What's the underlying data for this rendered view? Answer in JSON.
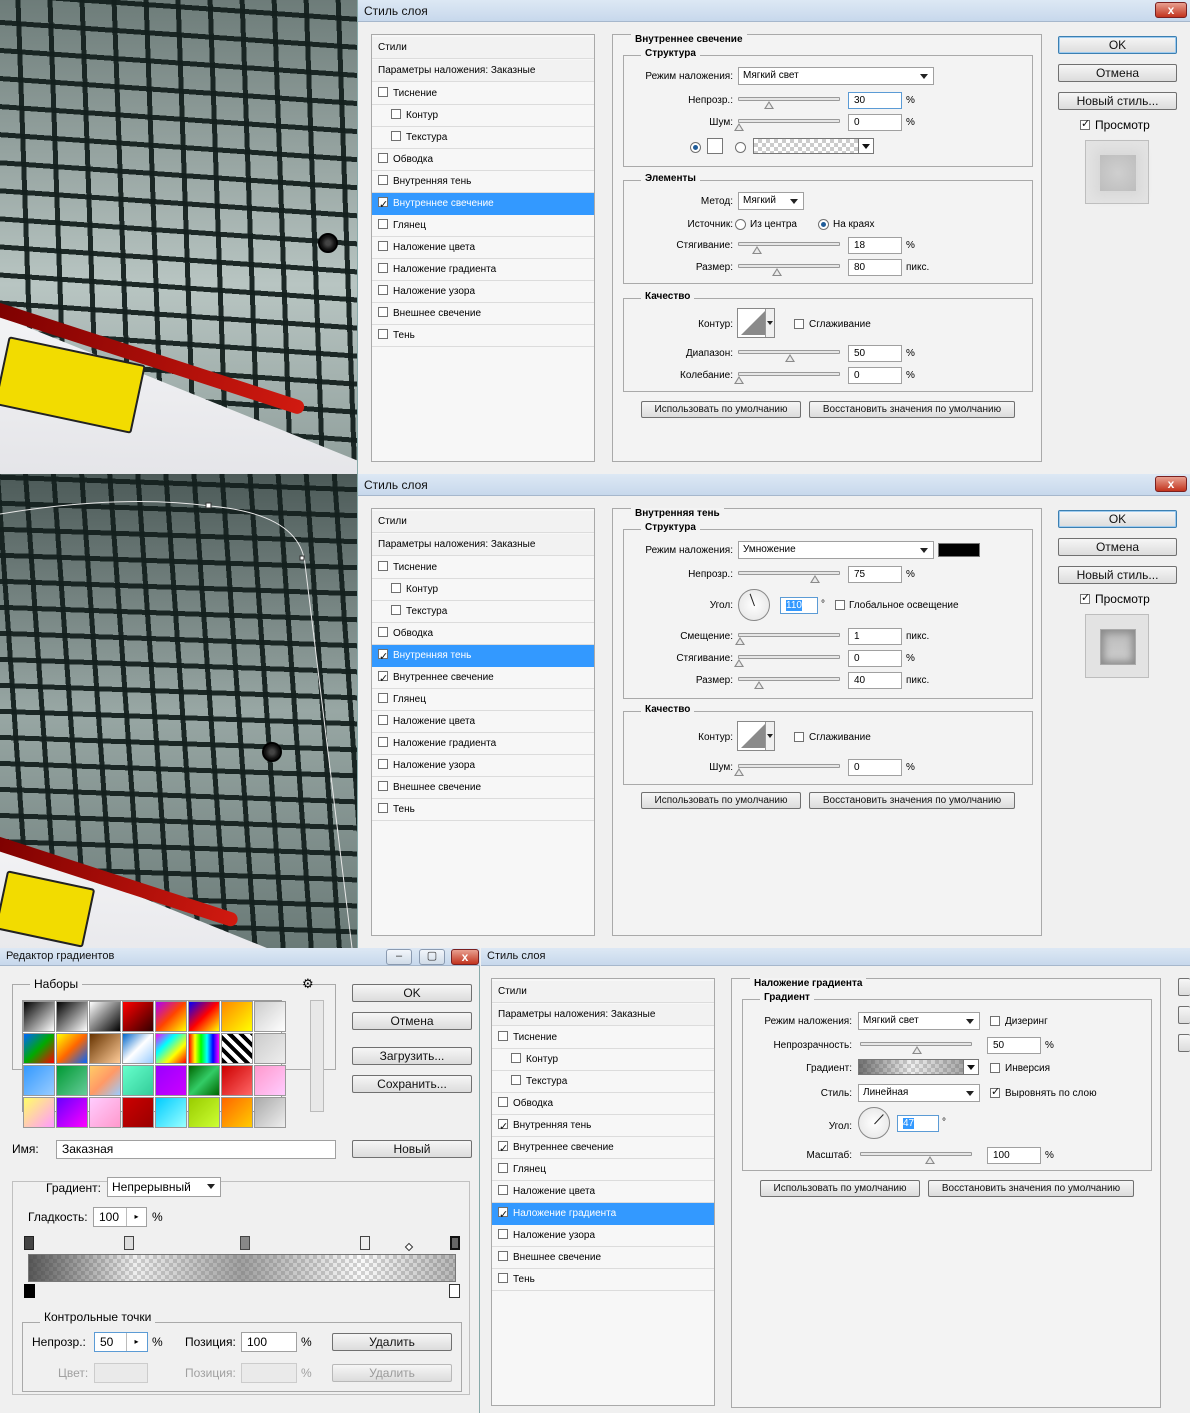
{
  "colors": {
    "selection": "#3399ff",
    "sticker": "#f2dc00",
    "stripe": "#c8150c",
    "black": "#000000",
    "white": "#ffffff"
  },
  "icons": [
    "close-icon",
    "minimize-icon",
    "maximize-icon",
    "gear-icon",
    "chevron-down-icon",
    "checkmark-icon",
    "radio-icon",
    "slider-thumb-icon",
    "color-stop-icon",
    "opacity-stop-icon"
  ],
  "dialog1": {
    "title": "Стиль слоя",
    "close": "x",
    "styles_header": "Стили",
    "blend_header": "Параметры наложения: Заказные",
    "items": [
      {
        "label": "Тиснение",
        "checked": false,
        "indent": false
      },
      {
        "label": "Контур",
        "checked": false,
        "indent": true
      },
      {
        "label": "Текстура",
        "checked": false,
        "indent": true
      },
      {
        "label": "Обводка",
        "checked": false,
        "indent": false
      },
      {
        "label": "Внутренняя тень",
        "checked": false,
        "indent": false
      },
      {
        "label": "Внутреннее свечение",
        "checked": true,
        "indent": false,
        "selected": true
      },
      {
        "label": "Глянец",
        "checked": false,
        "indent": false
      },
      {
        "label": "Наложение цвета",
        "checked": false,
        "indent": false
      },
      {
        "label": "Наложение градиента",
        "checked": false,
        "indent": false
      },
      {
        "label": "Наложение узора",
        "checked": false,
        "indent": false
      },
      {
        "label": "Внешнее свечение",
        "checked": false,
        "indent": false
      },
      {
        "label": "Тень",
        "checked": false,
        "indent": false
      }
    ],
    "section": "Внутреннее свечение",
    "structure": "Структура",
    "blend_label": "Режим наложения:",
    "blend_value": "Мягкий свет",
    "opacity_label": "Непрозр.:",
    "opacity_value": "30",
    "noise_label": "Шум:",
    "noise_value": "0",
    "pct": "%",
    "px": "пикс.",
    "elements": "Элементы",
    "method_label": "Метод:",
    "method_value": "Мягкий",
    "source_label": "Источник:",
    "source_center": "Из центра",
    "source_edge": "На краях",
    "choke_label": "Стягивание:",
    "choke_value": "18",
    "size_label": "Размер:",
    "size_value": "80",
    "quality": "Качество",
    "contour_label": "Контур:",
    "antialias": "Сглаживание",
    "range_label": "Диапазон:",
    "range_value": "50",
    "jitter_label": "Колебание:",
    "jitter_value": "0",
    "default_btn": "Использовать по умолчанию",
    "reset_btn": "Восстановить значения по умолчанию",
    "ok": "OK",
    "cancel": "Отмена",
    "new_style": "Новый стиль...",
    "preview": "Просмотр"
  },
  "dialog2": {
    "title": "Стиль слоя",
    "close": "x",
    "styles_header": "Стили",
    "blend_header": "Параметры наложения: Заказные",
    "items": [
      {
        "label": "Тиснение",
        "checked": false,
        "indent": false
      },
      {
        "label": "Контур",
        "checked": false,
        "indent": true
      },
      {
        "label": "Текстура",
        "checked": false,
        "indent": true
      },
      {
        "label": "Обводка",
        "checked": false,
        "indent": false
      },
      {
        "label": "Внутренняя тень",
        "checked": true,
        "indent": false,
        "selected": true
      },
      {
        "label": "Внутреннее свечение",
        "checked": true,
        "indent": false
      },
      {
        "label": "Глянец",
        "checked": false,
        "indent": false
      },
      {
        "label": "Наложение цвета",
        "checked": false,
        "indent": false
      },
      {
        "label": "Наложение градиента",
        "checked": false,
        "indent": false
      },
      {
        "label": "Наложение узора",
        "checked": false,
        "indent": false
      },
      {
        "label": "Внешнее свечение",
        "checked": false,
        "indent": false
      },
      {
        "label": "Тень",
        "checked": false,
        "indent": false
      }
    ],
    "section": "Внутренняя тень",
    "structure": "Структура",
    "blend_label": "Режим наложения:",
    "blend_value": "Умножение",
    "opacity_label": "Непрозр.:",
    "opacity_value": "75",
    "angle_label": "Угол:",
    "angle_value": "110",
    "deg": "°",
    "global_light": "Глобальное освещение",
    "distance_label": "Смещение:",
    "distance_value": "1",
    "choke_label": "Стягивание:",
    "choke_value": "0",
    "size_label": "Размер:",
    "size_value": "40",
    "pct": "%",
    "px": "пикс.",
    "quality": "Качество",
    "contour_label": "Контур:",
    "antialias": "Сглаживание",
    "noise_label": "Шум:",
    "noise_value": "0",
    "default_btn": "Использовать по умолчанию",
    "reset_btn": "Восстановить значения по умолчанию",
    "ok": "OK",
    "cancel": "Отмена",
    "new_style": "Новый стиль...",
    "preview": "Просмотр"
  },
  "gradient_editor": {
    "title": "Редактор градиентов",
    "presets": "Наборы",
    "ok": "OK",
    "cancel": "Отмена",
    "load": "Загрузить...",
    "save": "Сохранить...",
    "name_label": "Имя:",
    "name_value": "Заказная",
    "new_btn": "Новый",
    "gradient_label": "Градиент:",
    "gradient_type": "Непрерывный",
    "smooth_label": "Гладкость:",
    "smooth_value": "100",
    "pct": "%",
    "stops": "Контрольные точки",
    "opacity_label": "Непрозр.:",
    "opacity_value": "50",
    "position_label": "Позиция:",
    "position_value": "100",
    "delete_btn": "Удалить",
    "color_label": "Цвет:",
    "color_position_label": "Позиция:",
    "color_delete_btn": "Удалить"
  },
  "dialog3": {
    "title": "Стиль слоя",
    "styles_header": "Стили",
    "blend_header": "Параметры наложения: Заказные",
    "items": [
      {
        "label": "Тиснение",
        "checked": false,
        "indent": false
      },
      {
        "label": "Контур",
        "checked": false,
        "indent": true
      },
      {
        "label": "Текстура",
        "checked": false,
        "indent": true
      },
      {
        "label": "Обводка",
        "checked": false,
        "indent": false
      },
      {
        "label": "Внутренняя тень",
        "checked": true,
        "indent": false
      },
      {
        "label": "Внутреннее свечение",
        "checked": true,
        "indent": false
      },
      {
        "label": "Глянец",
        "checked": false,
        "indent": false
      },
      {
        "label": "Наложение цвета",
        "checked": false,
        "indent": false
      },
      {
        "label": "Наложение градиента",
        "checked": true,
        "indent": false,
        "selected": true
      },
      {
        "label": "Наложение узора",
        "checked": false,
        "indent": false
      },
      {
        "label": "Внешнее свечение",
        "checked": false,
        "indent": false
      },
      {
        "label": "Тень",
        "checked": false,
        "indent": false
      }
    ],
    "section": "Наложение градиента",
    "gradient_group": "Градиент",
    "blend_label": "Режим наложения:",
    "blend_value": "Мягкий свет",
    "dither": "Дизеринг",
    "opacity_label": "Непрозрачность:",
    "opacity_value": "50",
    "gradient_label": "Градиент:",
    "reverse": "Инверсия",
    "style_label": "Стиль:",
    "style_value": "Линейная",
    "align": "Выровнять по слою",
    "angle_label": "Угол:",
    "angle_value": "47",
    "deg": "°",
    "scale_label": "Масштаб:",
    "scale_value": "100",
    "pct": "%",
    "default_btn": "Использовать по умолчанию",
    "reset_btn": "Восстановить значения по умолчанию"
  }
}
